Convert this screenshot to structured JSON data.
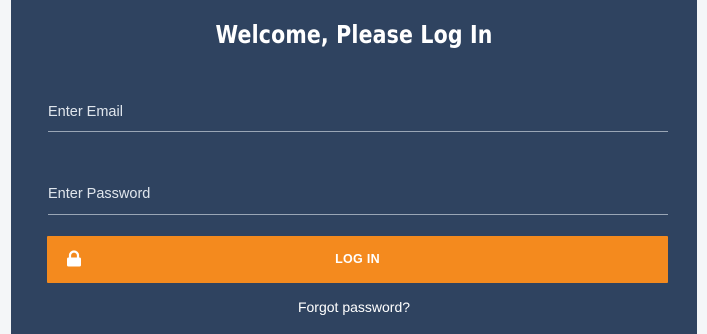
{
  "header": {
    "title": "Welcome, Please Log In"
  },
  "form": {
    "email": {
      "value": "",
      "placeholder": "Enter Email"
    },
    "password": {
      "value": "",
      "placeholder": "Enter Password"
    },
    "login_button": {
      "label": "LOG IN",
      "icon": "lock-icon"
    },
    "forgot_link": "Forgot password?"
  },
  "colors": {
    "page_background": "#f4f6f8",
    "panel_background": "#2f4360",
    "accent": "#f48a1e",
    "text": "#ffffff",
    "field_underline": "#9aa6b6"
  }
}
